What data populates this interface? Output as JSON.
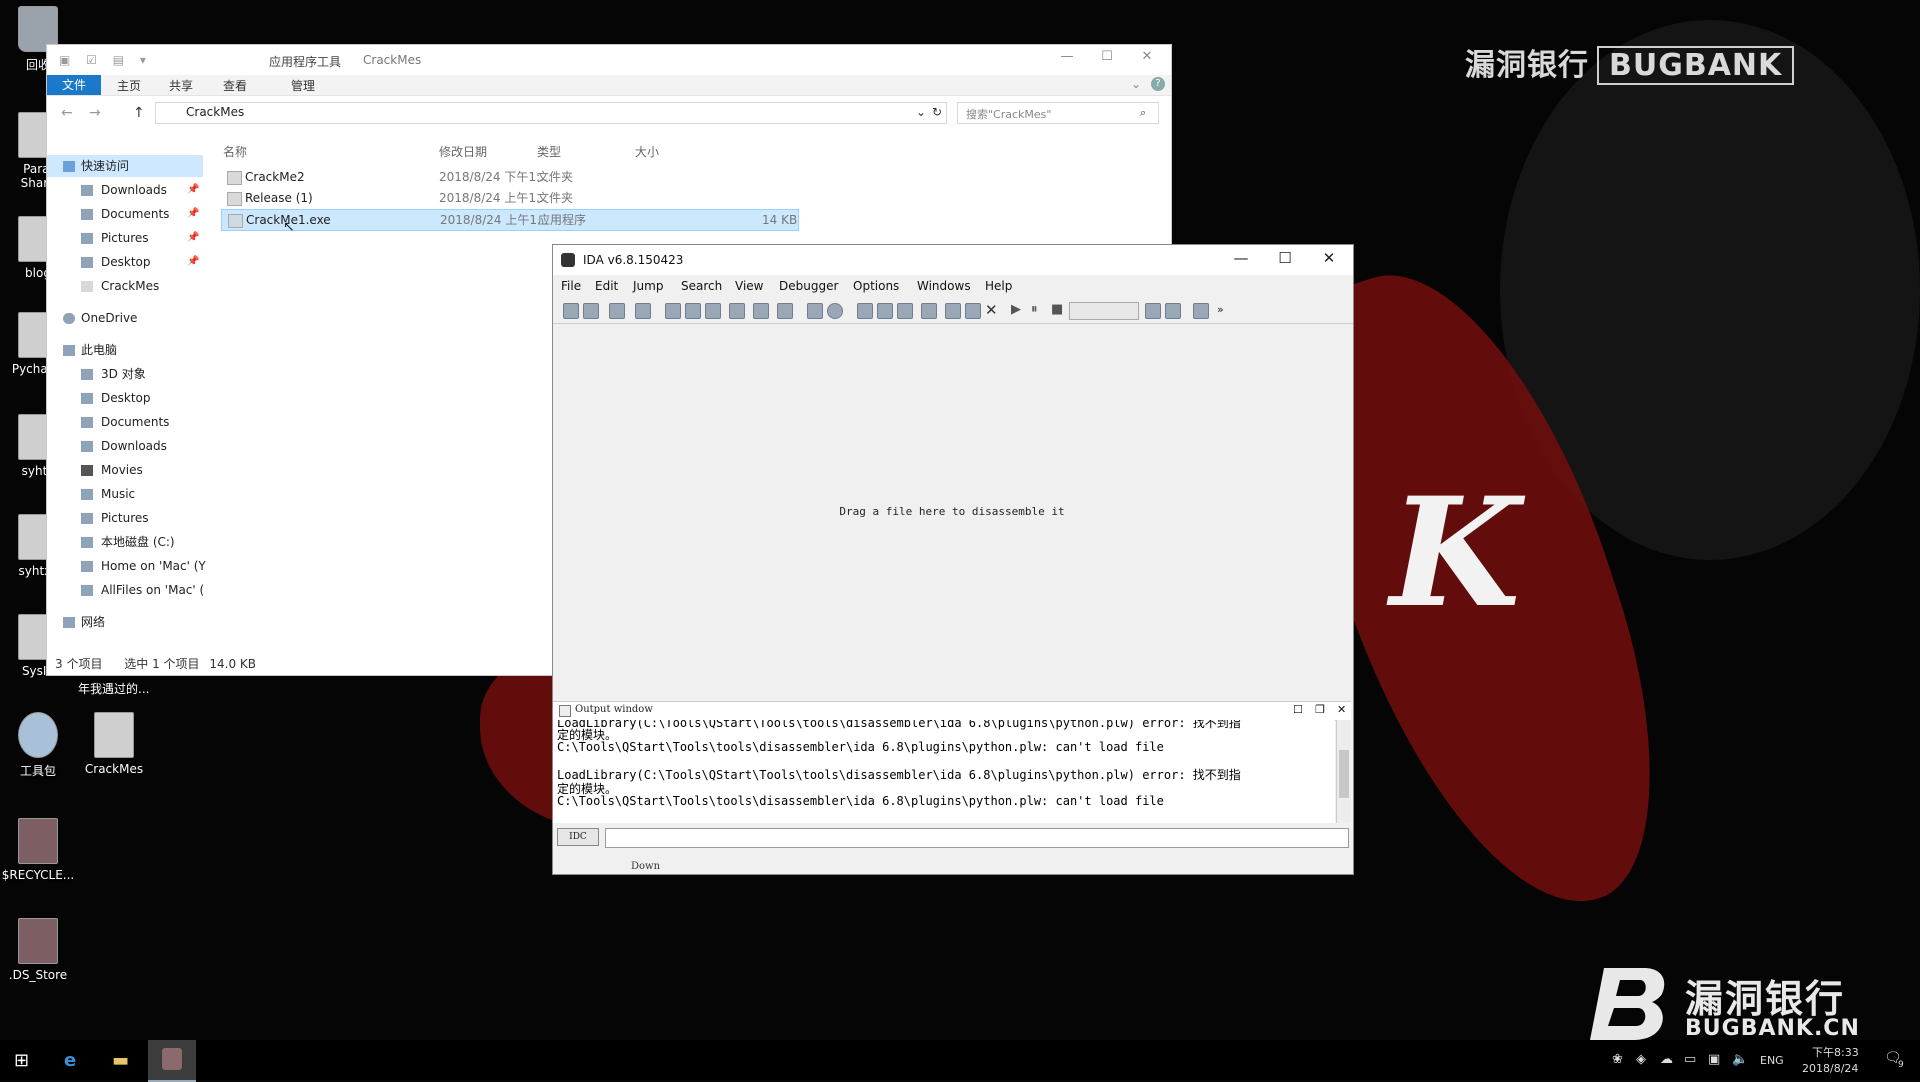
{
  "desktop": {
    "watermark_top": "漏洞银行",
    "watermark_top_box": "BUGBANK",
    "big_letter": "K",
    "logo_cn": "漏洞银行",
    "logo_en": "BUGBANK.CN",
    "icons": [
      {
        "label": "回收",
        "icon": "recycle-bin-icon"
      },
      {
        "label": "Paral\nShare",
        "icon": "shared-folder-icon"
      },
      {
        "label": "blog",
        "icon": "document-icon"
      },
      {
        "label": "Pycharm",
        "icon": "app-icon"
      },
      {
        "label": "syhtx",
        "icon": "document-icon"
      },
      {
        "label": "syhtxs",
        "icon": "document-icon"
      },
      {
        "label": "SysIn",
        "icon": "document-icon"
      },
      {
        "label": "工具包",
        "icon": "magnifier-icon"
      },
      {
        "label": "CrackMes",
        "icon": "folder-icon"
      },
      {
        "label": "$RECYCLE...",
        "icon": "archive-icon"
      },
      {
        "label": ".DS_Store",
        "icon": "archive-icon"
      }
    ],
    "partial_text": "年我遇过的..."
  },
  "explorer": {
    "contextual_tab": "应用程序工具",
    "title": "CrackMes",
    "ribbon": {
      "file": "文件",
      "home": "主页",
      "share": "共享",
      "view": "查看",
      "manage": "管理"
    },
    "address": "CrackMes",
    "search_placeholder": "搜索\"CrackMes\"",
    "columns": {
      "name": "名称",
      "date": "修改日期",
      "type": "类型",
      "size": "大小"
    },
    "files": [
      {
        "name": "CrackMe2",
        "date": "2018/8/24 下午1:...",
        "type": "文件夹",
        "size": ""
      },
      {
        "name": "Release (1)",
        "date": "2018/8/24 上午1...",
        "type": "文件夹",
        "size": ""
      },
      {
        "name": "CrackMe1.exe",
        "date": "2018/8/24 上午1...",
        "type": "应用程序",
        "size": "14 KB"
      }
    ],
    "sidebar": {
      "quick_access": "快速访问",
      "quick_items": [
        "Downloads",
        "Documents",
        "Pictures",
        "Desktop",
        "CrackMes"
      ],
      "onedrive": "OneDrive",
      "this_pc": "此电脑",
      "pc_items": [
        "3D 对象",
        "Desktop",
        "Documents",
        "Downloads",
        "Movies",
        "Music",
        "Pictures",
        "本地磁盘 (C:)",
        "Home on 'Mac' (Y",
        "AllFiles on 'Mac' ("
      ],
      "network": "网络"
    },
    "status": {
      "count": "3 个项目",
      "selected": "选中 1 个项目",
      "size": "14.0 KB"
    }
  },
  "ida": {
    "title": "IDA v6.8.150423",
    "menu": [
      "File",
      "Edit",
      "Jump",
      "Search",
      "View",
      "Debugger",
      "Options",
      "Windows",
      "Help"
    ],
    "drop_hint": "Drag a file here to disassemble it",
    "output_title": "Output window",
    "output_lines": [
      "LoadLibrary(C:\\Tools\\QStart\\Tools\\tools\\disassembler\\ida 6.8\\plugins\\python.plw) error: 找不到指",
      "定的模块。",
      "C:\\Tools\\QStart\\Tools\\tools\\disassembler\\ida 6.8\\plugins\\python.plw: can't load file",
      "",
      "LoadLibrary(C:\\Tools\\QStart\\Tools\\tools\\disassembler\\ida 6.8\\plugins\\python.plw) error: 找不到指",
      "定的模块。",
      "C:\\Tools\\QStart\\Tools\\tools\\disassembler\\ida 6.8\\plugins\\python.plw: can't load file"
    ],
    "idc_label": "IDC",
    "status": "Down"
  },
  "taskbar": {
    "lang": "ENG",
    "time": "下午8:33",
    "date": "2018/8/24",
    "notif_count": "9"
  }
}
